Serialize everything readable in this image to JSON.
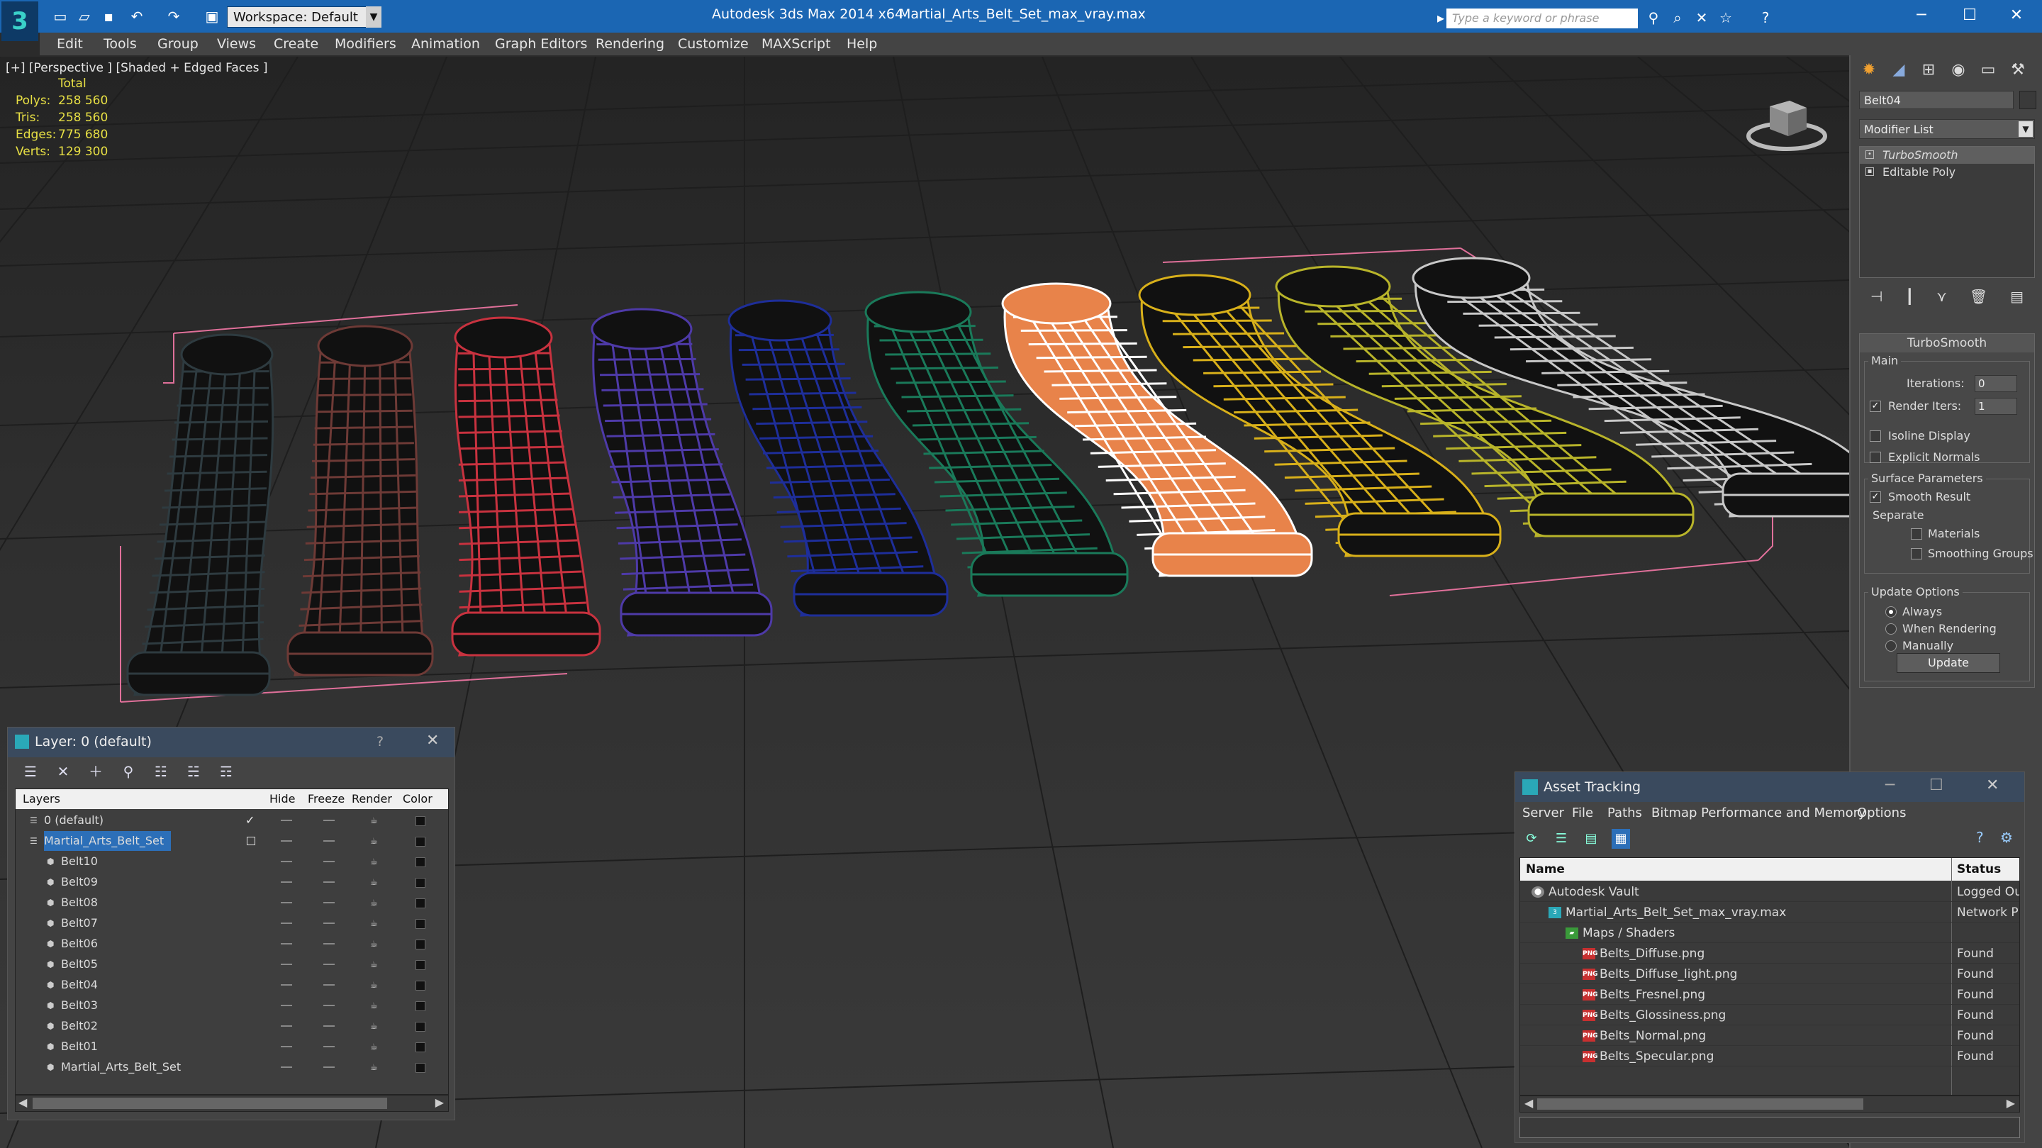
{
  "titlebar": {
    "workspace": "Workspace: Default",
    "app_title": "Autodesk 3ds Max  2014 x64",
    "file_name": "Martial_Arts_Belt_Set_max_vray.max",
    "search_placeholder": "Type a keyword or phrase"
  },
  "menu": [
    "Edit",
    "Tools",
    "Group",
    "Views",
    "Create",
    "Modifiers",
    "Animation",
    "Graph Editors",
    "Rendering",
    "Customize",
    "MAXScript",
    "Help"
  ],
  "viewport": {
    "label": "[+] [Perspective ] [Shaded + Edged Faces ]",
    "stats": {
      "total_label": "Total",
      "rows": [
        {
          "key": "Polys:",
          "value": "258 560"
        },
        {
          "key": "Tris:",
          "value": "258 560"
        },
        {
          "key": "Edges:",
          "value": "775 680"
        },
        {
          "key": "Verts:",
          "value": "129 300"
        }
      ]
    },
    "belts": [
      {
        "name": "Belt10",
        "color": "#2e3b40"
      },
      {
        "name": "Belt09",
        "color": "#6e3a36"
      },
      {
        "name": "Belt08",
        "color": "#c8323f"
      },
      {
        "name": "Belt07",
        "color": "#4e3aa8"
      },
      {
        "name": "Belt06",
        "color": "#1e2e9a"
      },
      {
        "name": "Belt05",
        "color": "#1a7a5a"
      },
      {
        "name": "Belt04",
        "color": "#ffffff"
      },
      {
        "name": "Belt03",
        "color": "#d8b01a"
      },
      {
        "name": "Belt02",
        "color": "#b8b42a"
      },
      {
        "name": "Belt01",
        "color": "#c8c8c8"
      }
    ]
  },
  "command_panel": {
    "object_name": "Belt04",
    "modifier_list": "Modifier List",
    "stack": [
      "TurboSmooth",
      "Editable Poly"
    ],
    "rollout_title": "TurboSmooth",
    "main_label": "Main",
    "iterations_label": "Iterations:",
    "iterations_value": "0",
    "render_iters_label": "Render Iters:",
    "render_iters_value": "1",
    "isoline_label": "Isoline Display",
    "explicit_normals_label": "Explicit Normals",
    "surface_params_label": "Surface Parameters",
    "smooth_result_label": "Smooth Result",
    "separate_label": "Separate",
    "materials_label": "Materials",
    "smoothing_groups_label": "Smoothing Groups",
    "update_options_label": "Update Options",
    "always_label": "Always",
    "when_rendering_label": "When Rendering",
    "manually_label": "Manually",
    "update_button": "Update"
  },
  "layer_panel": {
    "title": "Layer: 0 (default)",
    "help": "?",
    "headers": {
      "layers": "Layers",
      "hide": "Hide",
      "freeze": "Freeze",
      "render": "Render",
      "color": "Color"
    },
    "rows": [
      {
        "name": "0 (default)",
        "level": 0
      },
      {
        "name": "Martial_Arts_Belt_Set",
        "level": 0,
        "selected": true
      },
      {
        "name": "Belt10",
        "level": 1
      },
      {
        "name": "Belt09",
        "level": 1
      },
      {
        "name": "Belt08",
        "level": 1
      },
      {
        "name": "Belt07",
        "level": 1
      },
      {
        "name": "Belt06",
        "level": 1
      },
      {
        "name": "Belt05",
        "level": 1
      },
      {
        "name": "Belt04",
        "level": 1
      },
      {
        "name": "Belt03",
        "level": 1
      },
      {
        "name": "Belt02",
        "level": 1
      },
      {
        "name": "Belt01",
        "level": 1
      },
      {
        "name": "Martial_Arts_Belt_Set",
        "level": 1
      }
    ]
  },
  "asset_panel": {
    "title": "Asset Tracking",
    "menu": [
      "Server",
      "File",
      "Paths",
      "Bitmap Performance and Memory",
      "Options"
    ],
    "headers": {
      "name": "Name",
      "status": "Status"
    },
    "rows": [
      {
        "name": "Autodesk Vault",
        "status": "Logged Ou",
        "level": 0,
        "icon": "vault"
      },
      {
        "name": "Martial_Arts_Belt_Set_max_vray.max",
        "status": "Network P",
        "level": 1,
        "icon": "max"
      },
      {
        "name": "Maps / Shaders",
        "status": "",
        "level": 2,
        "icon": "folder"
      },
      {
        "name": "Belts_Diffuse.png",
        "status": "Found",
        "level": 3,
        "icon": "png"
      },
      {
        "name": "Belts_Diffuse_light.png",
        "status": "Found",
        "level": 3,
        "icon": "png"
      },
      {
        "name": "Belts_Fresnel.png",
        "status": "Found",
        "level": 3,
        "icon": "png"
      },
      {
        "name": "Belts_Glossiness.png",
        "status": "Found",
        "level": 3,
        "icon": "png"
      },
      {
        "name": "Belts_Normal.png",
        "status": "Found",
        "level": 3,
        "icon": "png"
      },
      {
        "name": "Belts_Specular.png",
        "status": "Found",
        "level": 3,
        "icon": "png"
      }
    ]
  }
}
